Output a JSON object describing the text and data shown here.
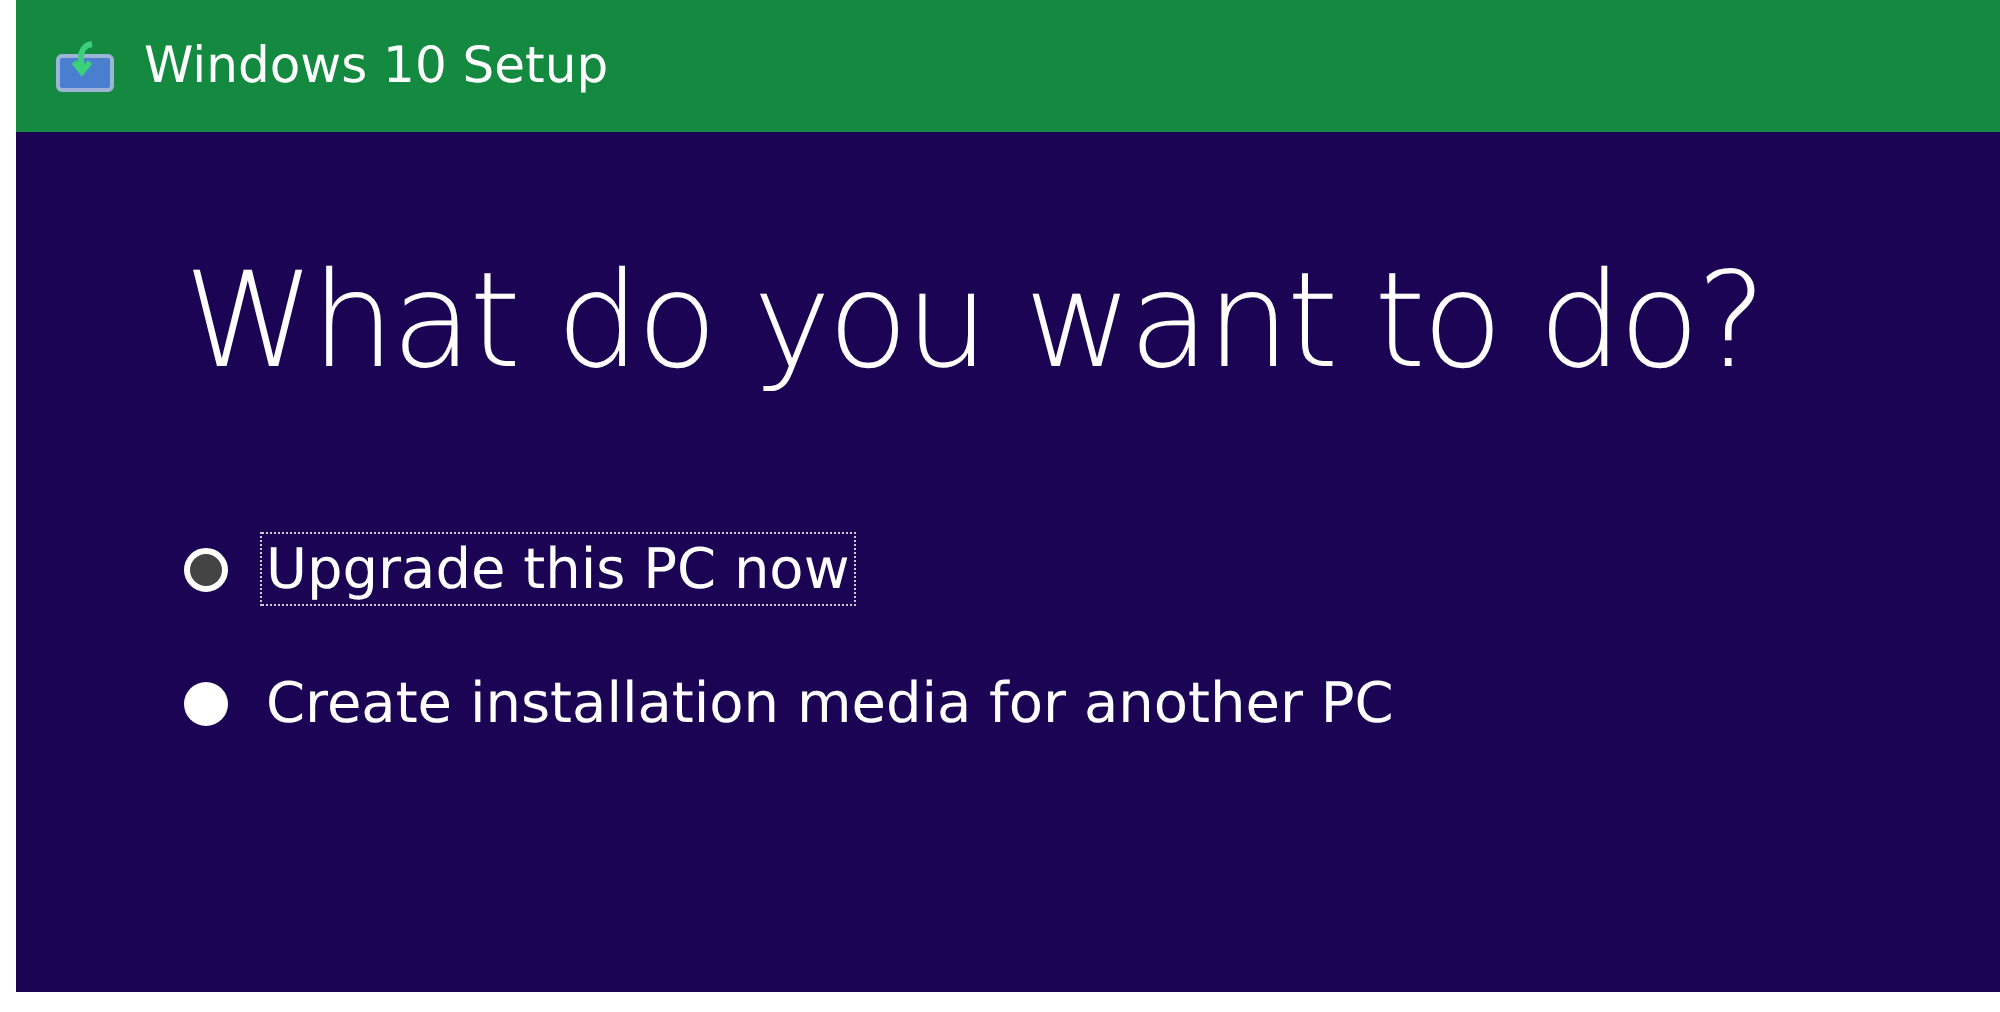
{
  "window": {
    "title": "Windows 10 Setup"
  },
  "heading": "What do you want to do?",
  "options": [
    {
      "label": "Upgrade this PC now",
      "selected": true,
      "focused": true
    },
    {
      "label": "Create installation media for another PC",
      "selected": false,
      "focused": false
    }
  ]
}
